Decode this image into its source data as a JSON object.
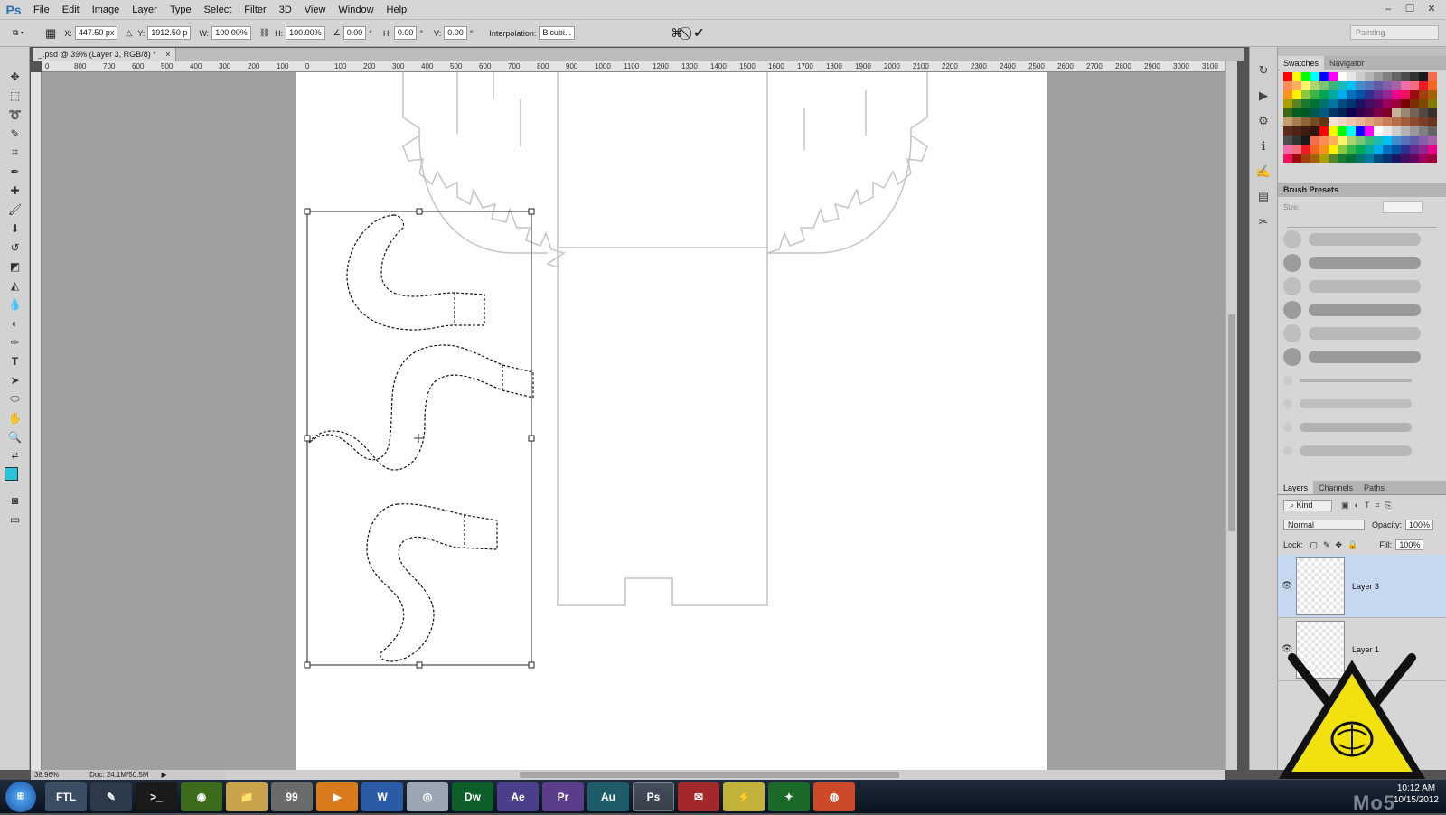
{
  "app": {
    "logo": "Ps"
  },
  "menu": [
    "File",
    "Edit",
    "Image",
    "Layer",
    "Type",
    "Select",
    "Filter",
    "3D",
    "View",
    "Window",
    "Help"
  ],
  "window_controls": {
    "minimize": "–",
    "restore": "❐",
    "close": "✕"
  },
  "options_bar": {
    "x_label": "X:",
    "x_value": "447.50 px",
    "y_label": "Y:",
    "y_value": "1912.50 p",
    "w_label": "W:",
    "w_value": "100.00%",
    "h_label": "H:",
    "h_value": "100.00%",
    "angle_value": "0.00",
    "angle_unit": "°",
    "hskew_label": "H:",
    "hskew_value": "0.00",
    "hskew_unit": "°",
    "vskew_label": "V:",
    "vskew_value": "0.00",
    "vskew_unit": "°",
    "interp_label": "Interpolation:",
    "interp_value": "Bicubi...",
    "workspace": "Painting"
  },
  "document_tab": {
    "title": "_.psd @ 39% (Layer 3, RGB/8) *",
    "close": "×"
  },
  "rulers": {
    "h_ticks": [
      "0",
      "800",
      "700",
      "600",
      "500",
      "400",
      "300",
      "200",
      "100",
      "0",
      "100",
      "200",
      "300",
      "400",
      "500",
      "600",
      "700",
      "800",
      "900",
      "1000",
      "1100",
      "1200",
      "1300",
      "1400",
      "1500",
      "1600",
      "1700",
      "1800",
      "1900",
      "2000",
      "2100",
      "2200",
      "2300",
      "2400",
      "2500",
      "2600",
      "2700",
      "2800",
      "2900",
      "3000",
      "3100"
    ]
  },
  "status_bar": {
    "zoom": "38.96%",
    "doc_size": "Doc: 24.1M/50.5M"
  },
  "panels": {
    "swatches_tabs": [
      "Swatches",
      "Navigator"
    ],
    "brush_presets_title": "Brush Presets",
    "brush_size_label": "Size:",
    "layers_tabs": [
      "Layers",
      "Channels",
      "Paths"
    ],
    "kind_label": "Kind",
    "blend_mode": "Normal",
    "opacity_label": "Opacity:",
    "opacity_value": "100%",
    "lock_label": "Lock:",
    "fill_label": "Fill:",
    "fill_value": "100%",
    "layers": [
      {
        "name": "Layer 3",
        "selected": true
      },
      {
        "name": "Layer 1",
        "selected": false
      }
    ]
  },
  "taskbar": {
    "apps": [
      {
        "label": "FTL",
        "color": "#3a4d63",
        "active": false
      },
      {
        "label": "✎",
        "color": "#2c3a4a",
        "active": false
      },
      {
        "label": ">_",
        "color": "#1a1a1a",
        "active": false
      },
      {
        "label": "◉",
        "color": "#3c6b1c",
        "active": false
      },
      {
        "label": "📁",
        "color": "#c9a24c",
        "active": false
      },
      {
        "label": "99",
        "color": "#6b6b6b",
        "active": false
      },
      {
        "label": "▶",
        "color": "#d97a1c",
        "active": false
      },
      {
        "label": "W",
        "color": "#2b5aa6",
        "active": false
      },
      {
        "label": "◎",
        "color": "#9aa6b4",
        "active": false
      },
      {
        "label": "Dw",
        "color": "#0e5e2a",
        "active": false
      },
      {
        "label": "Ae",
        "color": "#4b3f8c",
        "active": false
      },
      {
        "label": "Pr",
        "color": "#5a3e8c",
        "active": false
      },
      {
        "label": "Au",
        "color": "#1f5c6a",
        "active": false
      },
      {
        "label": "Ps",
        "color": "#0f2d5a",
        "active": true
      },
      {
        "label": "✉",
        "color": "#a3282a",
        "active": false
      },
      {
        "label": "⚡",
        "color": "#c2b23a",
        "active": false
      },
      {
        "label": "✦",
        "color": "#1c6a2a",
        "active": false
      },
      {
        "label": "◍",
        "color": "#cc4a2a",
        "active": false
      }
    ],
    "clock_time": "10:12 AM",
    "clock_date": "10/15/2012",
    "watermark": "Mo5"
  },
  "colors": {
    "foreground": "#27c4d9",
    "background": "#ffffff",
    "accent": "#2b6fb6",
    "layer_selected": "#c6d7f0"
  }
}
